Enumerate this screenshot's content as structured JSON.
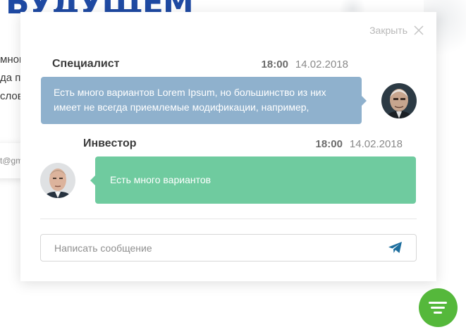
{
  "background": {
    "logo_fragment": "БУДУЩЕМ",
    "text_lines": [
      "много",
      "да п",
      "слов"
    ],
    "email_fragment": "t@gm"
  },
  "chat": {
    "close_label": "Закрыть",
    "close_icon": "close-icon",
    "messages": [
      {
        "author": "Специалист",
        "time": "18:00",
        "date": "14.02.2018",
        "text": "Есть много вариантов Lorem Ipsum, но большинство из них имеет не всегда приемлемые модификации, например,",
        "bubble_color": "#8fb1cd",
        "side": "right"
      },
      {
        "author": "Инвестор",
        "time": "18:00",
        "date": "14.02.2018",
        "text": "Есть много вариантов",
        "bubble_color": "#6fcb9f",
        "side": "left"
      }
    ],
    "input": {
      "placeholder": "Написать сообщение",
      "value": ""
    },
    "send_icon": "paper-plane-icon"
  },
  "fab": {
    "icon": "menu-lines-icon",
    "color": "#55b83b"
  },
  "colors": {
    "logo": "#1f4aa3",
    "author_text": "#3b3b3b",
    "date_text": "#8a8a8a",
    "send_icon": "#1d6e9e"
  }
}
